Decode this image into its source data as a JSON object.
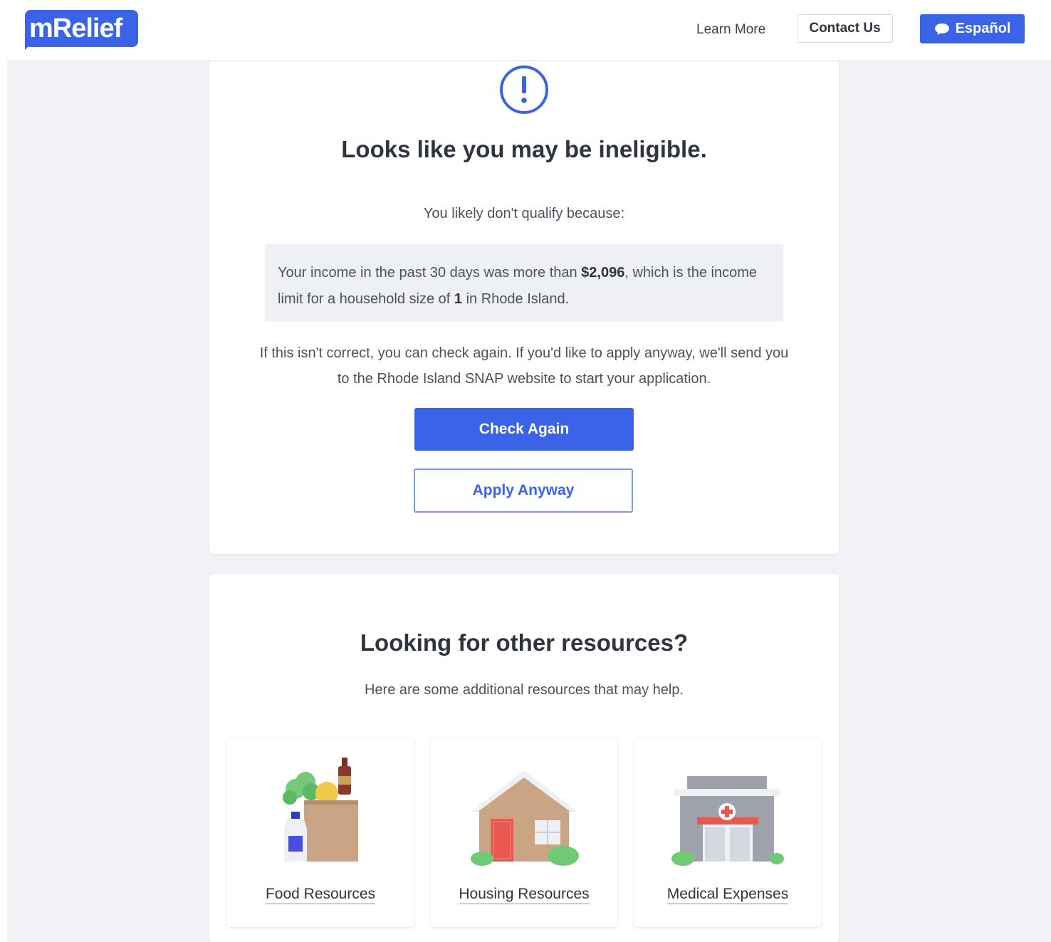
{
  "header": {
    "logo_text": "mRelief",
    "nav": {
      "learn_more": "Learn More",
      "contact_us": "Contact Us",
      "espanol": "Español"
    }
  },
  "result": {
    "title": "Looks like you may be ineligible.",
    "subtitle": "You likely don't qualify because:",
    "reason": {
      "part1": "Your income in the past 30 days was more than ",
      "amount": "$2,096",
      "part2": ", which is the income limit for a household size of ",
      "household_size": "1",
      "part3": " in Rhode Island."
    },
    "note": "If this isn't correct, you can check again. If you'd like to apply anyway, we'll send you to the Rhode Island SNAP website to start your application.",
    "check_again": "Check Again",
    "apply_anyway": "Apply Anyway"
  },
  "resources": {
    "title": "Looking for other resources?",
    "subtitle": "Here are some additional resources that may help.",
    "items": [
      {
        "label": "Food Resources",
        "icon": "grocery-bag-icon"
      },
      {
        "label": "Housing Resources",
        "icon": "house-icon"
      },
      {
        "label": "Medical Expenses",
        "icon": "hospital-icon"
      }
    ]
  },
  "colors": {
    "brand_blue": "#3a63e8",
    "page_bg": "#f1f2f5"
  }
}
